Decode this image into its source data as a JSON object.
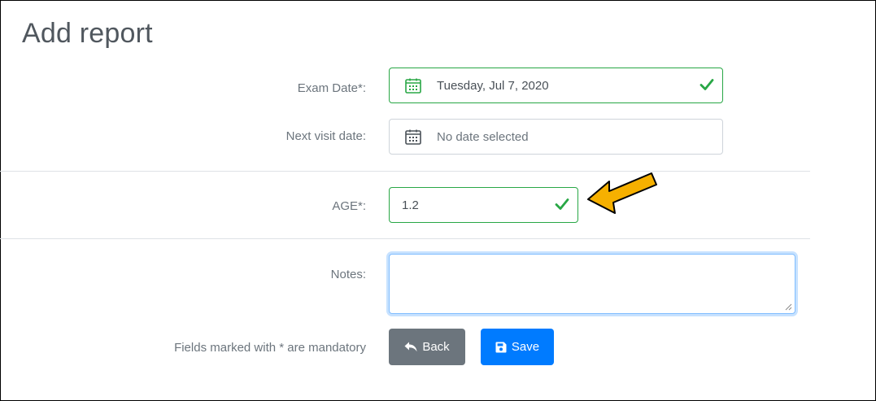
{
  "page": {
    "title": "Add report"
  },
  "form": {
    "exam_date": {
      "label": "Exam Date*:",
      "value": "Tuesday, Jul 7, 2020",
      "valid": true
    },
    "next_visit_date": {
      "label": "Next visit date:",
      "placeholder": "No date selected"
    },
    "age": {
      "label": "AGE*:",
      "value": "1.2",
      "valid": true
    },
    "notes": {
      "label": "Notes:",
      "value": ""
    },
    "mandatory_note": "Fields marked with * are mandatory"
  },
  "buttons": {
    "back_label": "Back",
    "save_label": "Save"
  },
  "icons": {
    "calendar": "calendar-icon",
    "check": "check-icon",
    "back": "reply-arrow-icon",
    "save": "floppy-disk-icon",
    "annotation": "pointer-arrow-icon"
  },
  "colors": {
    "valid": "#28a745",
    "primary": "#007bff",
    "secondary": "#6c757d",
    "focus": "#80bdff",
    "annotation_arrow": "#f6b000"
  }
}
